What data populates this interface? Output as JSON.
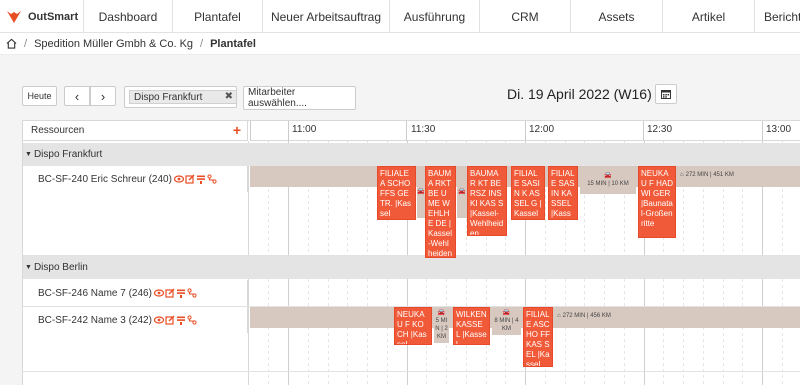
{
  "app": {
    "name": "OutSmart"
  },
  "nav": [
    {
      "label": "Dashboard"
    },
    {
      "label": "Plantafel"
    },
    {
      "label": "Neuer Arbeitsauftrag"
    },
    {
      "label": "Ausführung"
    },
    {
      "label": "CRM"
    },
    {
      "label": "Assets"
    },
    {
      "label": "Artikel"
    },
    {
      "label": "Bericht"
    }
  ],
  "breadcrumb": {
    "company": "Spedition Müller Gmbh & Co. Kg",
    "page": "Plantafel"
  },
  "toolbar": {
    "today": "Heute",
    "prev": "‹",
    "next": "›",
    "dispo_tag": "Dispo Frankfurt",
    "employee_placeholder": "Mitarbeiter auswählen....",
    "date": "Di. 19 April 2022 (W16)"
  },
  "grid": {
    "resources_label": "Ressourcen",
    "times": [
      "11:00",
      "11:30",
      "12:00",
      "12:30",
      "13:00"
    ],
    "groups": [
      {
        "name": "Dispo Frankfurt",
        "resources": [
          {
            "name": "BC-SF-240 Eric Schreur (240)"
          }
        ]
      },
      {
        "name": "Dispo Berlin",
        "resources": [
          {
            "name": "BC-SF-246 Name 7 (246)"
          },
          {
            "name": "BC-SF-242 Name 3 (242)"
          }
        ]
      }
    ]
  },
  "row1_tasks": [
    {
      "text": "FILIALE A SCHOFFS GETR. |Kassel"
    },
    {
      "text": "BAUMA RKT BE UME W EHLHE DE |Kassel-Wehlheiden"
    },
    {
      "text": "BAUMAR KT BERSZ INSKI KAS S |Kassel-Wehlheiden"
    },
    {
      "text": "FILIALE SASIN K ASSEL G |Kassel"
    },
    {
      "text": "FILIALE SASIN KASSEL |Kassel"
    },
    {
      "text": "NEUKAU F HADWI GER |Baunatal-Großenritte"
    }
  ],
  "row1_drives": [
    {
      "text": "15 MIN | 10 KM"
    },
    {
      "text": "272 MIN | 451 KM"
    }
  ],
  "row3_tasks": [
    {
      "text": "NEUKAU F KOCH |Kassel"
    },
    {
      "text": "WILKEN KASSEL |Kassel"
    },
    {
      "text": "FILIALE ASCHO FF KAS SEL |Kassel"
    }
  ],
  "row3_drives": [
    {
      "text": "5 MI N | 2 KM"
    },
    {
      "text": "8 MIN | 4 KM"
    },
    {
      "text": "272 MIN | 456 KM"
    }
  ],
  "colors": {
    "brand": "#e84d24",
    "task": "#f05a38",
    "drive": "#d7c9c0",
    "group": "#e4e4e4"
  }
}
